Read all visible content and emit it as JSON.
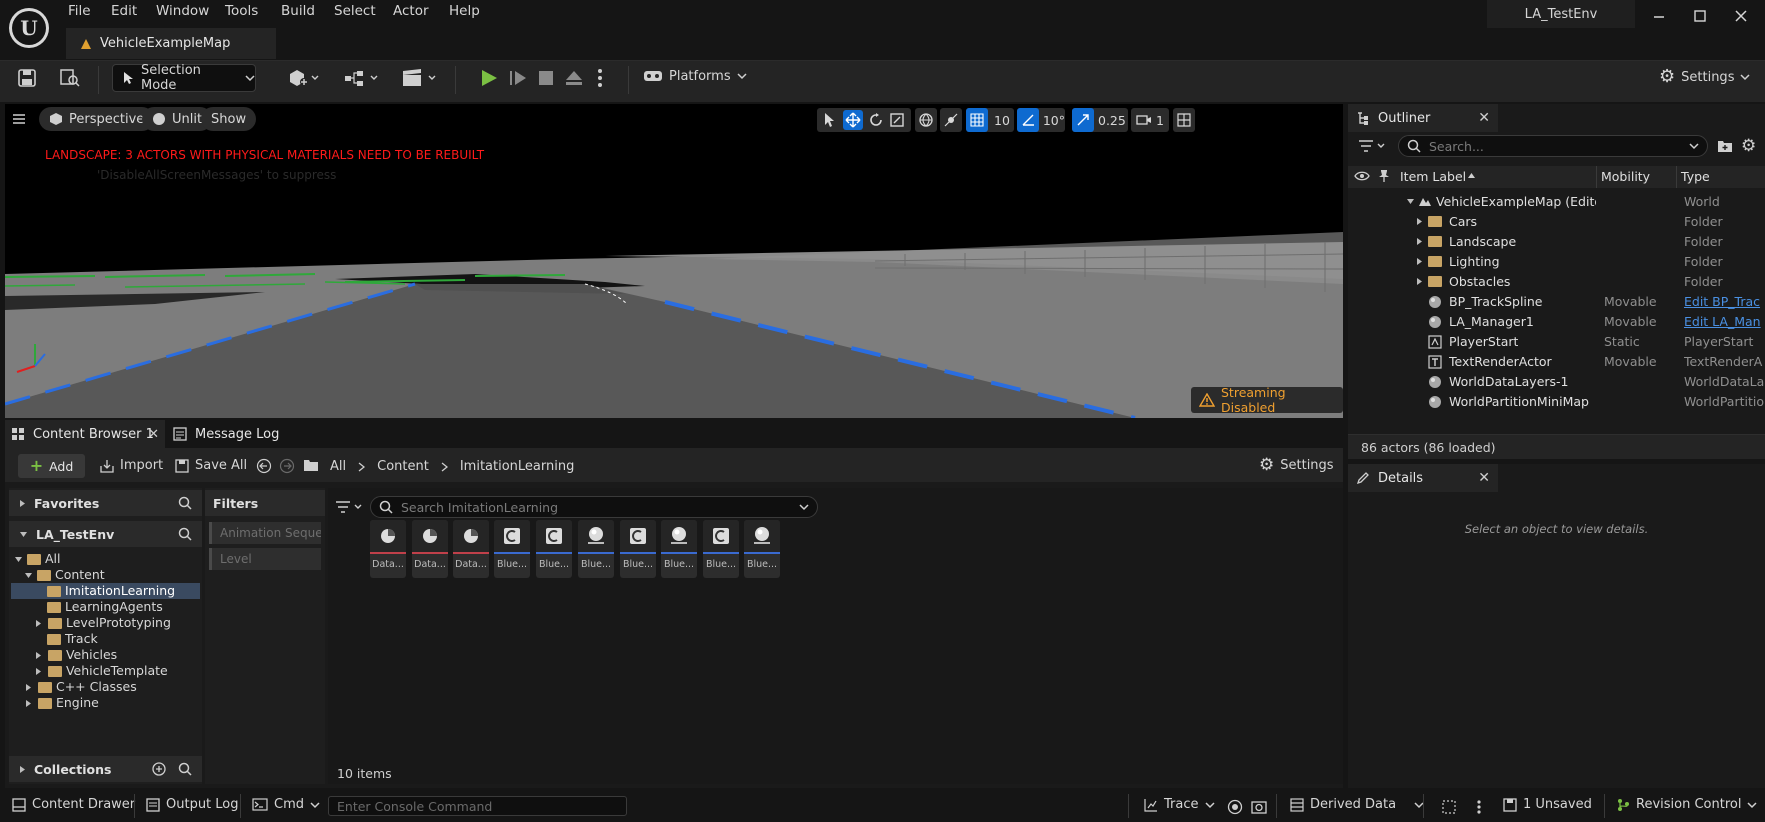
{
  "menu": [
    "File",
    "Edit",
    "Window",
    "Tools",
    "Build",
    "Select",
    "Actor",
    "Help"
  ],
  "project_name": "LA_TestEnv",
  "map_tab": "VehicleExampleMap",
  "toolbar": {
    "selection_mode": "Selection Mode",
    "platforms": "Platforms",
    "settings": "Settings"
  },
  "viewport": {
    "perspective": "Perspective",
    "unlit": "Unlit",
    "show": "Show",
    "grid_snap": "10",
    "rot_snap": "10°",
    "scale_snap": "0.25",
    "camera_speed": "1",
    "warning": "LANDSCAPE: 3 ACTORS WITH PHYSICAL MATERIALS NEED TO BE REBUILT",
    "warning_sub": "'DisableAllScreenMessages' to suppress",
    "streaming": "Streaming Disabled"
  },
  "outliner": {
    "tab": "Outliner",
    "search_placeholder": "Search...",
    "columns": [
      "Item Label",
      "Mobility",
      "Type"
    ],
    "rows": [
      {
        "label": "VehicleExampleMap (Editor)",
        "mobility": "",
        "type": "World"
      },
      {
        "label": "Cars",
        "mobility": "",
        "type": "Folder"
      },
      {
        "label": "Landscape",
        "mobility": "",
        "type": "Folder"
      },
      {
        "label": "Lighting",
        "mobility": "",
        "type": "Folder"
      },
      {
        "label": "Obstacles",
        "mobility": "",
        "type": "Folder"
      },
      {
        "label": "BP_TrackSpline",
        "mobility": "Movable",
        "type": "Edit BP_Trac"
      },
      {
        "label": "LA_Manager1",
        "mobility": "Movable",
        "type": "Edit LA_Man"
      },
      {
        "label": "PlayerStart",
        "mobility": "Static",
        "type": "PlayerStart"
      },
      {
        "label": "TextRenderActor",
        "mobility": "Movable",
        "type": "TextRenderA"
      },
      {
        "label": "WorldDataLayers-1",
        "mobility": "",
        "type": "WorldDataLa"
      },
      {
        "label": "WorldPartitionMiniMap",
        "mobility": "",
        "type": "WorldPartitio"
      }
    ],
    "footer": "86 actors (86 loaded)"
  },
  "details": {
    "tab": "Details",
    "empty": "Select an object to view details."
  },
  "content_browser": {
    "tab": "Content Browser 1",
    "tab2": "Message Log",
    "add": "Add",
    "import": "Import",
    "save_all": "Save All",
    "path": [
      "All",
      "Content",
      "ImitationLearning"
    ],
    "settings": "Settings",
    "favorites": "Favorites",
    "project": "LA_TestEnv",
    "tree": [
      "All",
      "Content",
      "ImitationLearning",
      "LearningAgents",
      "LevelPrototyping",
      "Track",
      "Vehicles",
      "VehicleTemplate",
      "C++ Classes",
      "Engine"
    ],
    "collections": "Collections",
    "filters": "Filters",
    "filter_items": [
      "Animation Sequence",
      "Level"
    ],
    "search_placeholder": "Search ImitationLearning",
    "assets": [
      "Data...",
      "Data...",
      "Data...",
      "Blue...",
      "Blue...",
      "Blue...",
      "Blue...",
      "Blue...",
      "Blue...",
      "Blue..."
    ],
    "item_count": "10 items"
  },
  "status": {
    "content_drawer": "Content Drawer",
    "output_log": "Output Log",
    "cmd": "Cmd",
    "console_placeholder": "Enter Console Command",
    "trace": "Trace",
    "derived_data": "Derived Data",
    "unsaved": "1 Unsaved",
    "revision_control": "Revision Control"
  },
  "colors": {
    "accent_blue": "#0e6ad0",
    "play_green": "#7bc043",
    "warning_red": "#ff1a1a",
    "streaming_orange": "#f0a030",
    "folder": "#c8a465"
  }
}
